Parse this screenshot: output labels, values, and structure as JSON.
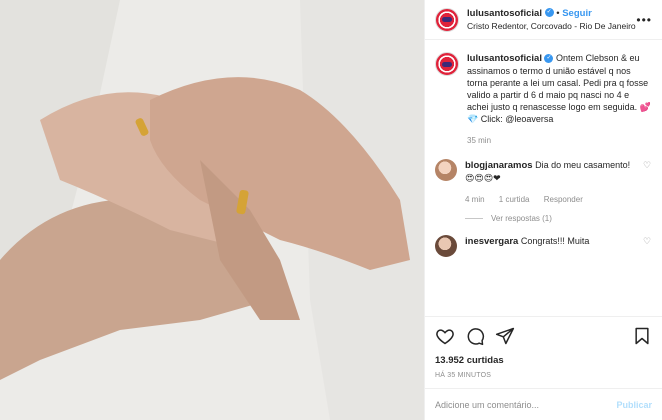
{
  "post": {
    "username": "lulusantosoficial",
    "follow_label": "Seguir",
    "separator": "•",
    "location": "Cristo Redentor, Corcovado - Rio De Janeiro",
    "more_icon": "more-dots-icon"
  },
  "caption": {
    "username": "lulusantosoficial",
    "text": "Ontem Clebson & eu assinamos o termo d união estável q nos torna perante a lei um casal. Pedi pra q fosse valido a partir d 6 d maio pq nasci no 4 e achei justo q renascesse logo em seguida. 💕💎 Click: @leoaversa",
    "time": "35 min"
  },
  "comments": [
    {
      "username": "blogjanaramos",
      "text": "Dia do meu casamento! 😍😍😍❤",
      "time": "4 min",
      "likes": "1 curtida",
      "reply_label": "Responder",
      "view_replies": "Ver respostas (1)"
    },
    {
      "username": "inesvergara",
      "text": "Congrats!!! Muita"
    }
  ],
  "actions": {
    "likes_count": "13.952 curtidas",
    "time_ago": "HÁ 35 MINUTOS"
  },
  "composer": {
    "placeholder": "Adicione um comentário...",
    "publish_label": "Publicar"
  },
  "colors": {
    "accent": "#3897f0",
    "muted": "#8e8e8e",
    "publish_disabled": "#b2dffc"
  }
}
